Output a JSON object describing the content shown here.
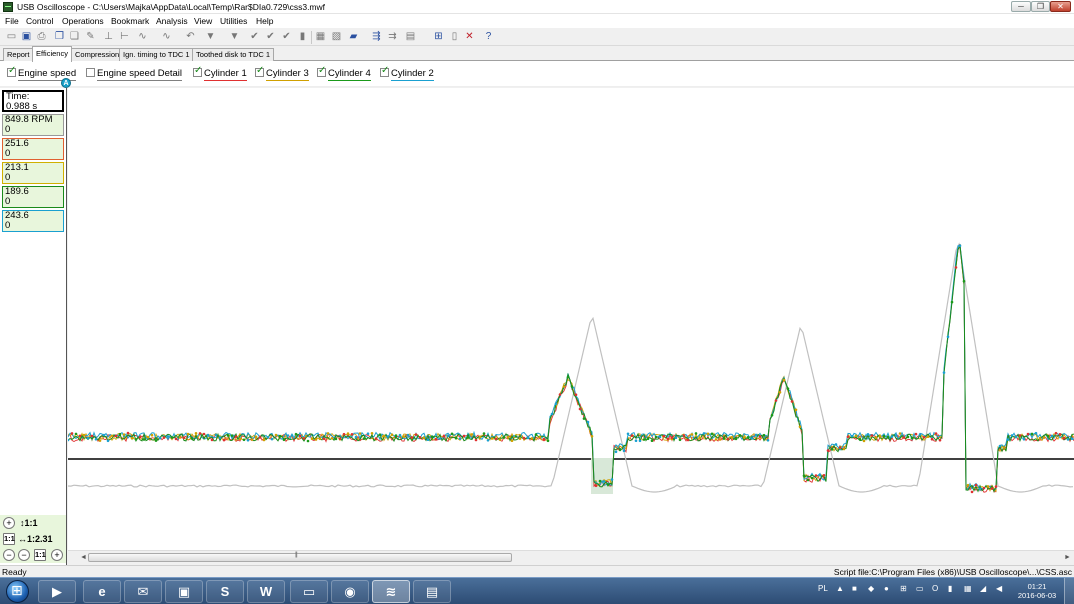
{
  "window": {
    "title": "USB Oscilloscope - C:\\Users\\Majka\\AppData\\Local\\Temp\\Rar$DIa0.729\\css3.mwf",
    "min": "─",
    "max": "❐",
    "close": "✕"
  },
  "menu": [
    "File",
    "Control",
    "Operations",
    "Bookmark",
    "Analysis",
    "View",
    "Utilities",
    "Help"
  ],
  "toolbar_icons": [
    "open-icon",
    "save-icon",
    "print-icon",
    "copy-icon",
    "copy2-icon",
    "edit-icon",
    "cursor-icon",
    "measure-icon",
    "wave-icon",
    "wave2-icon",
    "undo-icon",
    "marker-icon",
    "marker2-icon",
    "check-icon",
    "check2-icon",
    "check3-icon",
    "block-icon",
    "block2-icon",
    "block3-icon",
    "folder-icon",
    "trigger-icon",
    "trigger2-icon",
    "trigger3-icon",
    "display-icon",
    "zoom-icon",
    "view-icon",
    "close-icon",
    "help-icon"
  ],
  "tabs": [
    {
      "label": "Report"
    },
    {
      "label": "Efficiency",
      "active": true
    },
    {
      "label": "Compression"
    },
    {
      "label": "Ign. timing to TDC 1"
    },
    {
      "label": "Toothed disk to TDC 1"
    }
  ],
  "channels": [
    {
      "label": "Engine speed",
      "checked": true,
      "color": "#808080"
    },
    {
      "label": "Engine speed Detail",
      "checked": false,
      "color": "#808080"
    },
    {
      "label": "Cylinder 1",
      "checked": true,
      "color": "#e03030"
    },
    {
      "label": "Cylinder 3",
      "checked": true,
      "color": "#d0a000"
    },
    {
      "label": "Cylinder 4",
      "checked": true,
      "color": "#1a9a1a"
    },
    {
      "label": "Cylinder 2",
      "checked": true,
      "color": "#1aa0d0"
    }
  ],
  "cursor_marker": "A",
  "readouts": [
    {
      "line1": "Time:",
      "line2": "0.988 s",
      "border": "#000000",
      "bg": "#ffffff"
    },
    {
      "line1": "849.8 RPM",
      "line2": "0",
      "border": "#999999",
      "bg": "#e8f6dc"
    },
    {
      "line1": "251.6",
      "line2": "0",
      "border": "#e06030",
      "bg": "#e8f6dc"
    },
    {
      "line1": "213.1",
      "line2": "0",
      "border": "#d0b000",
      "bg": "#e8f6dc"
    },
    {
      "line1": "189.6",
      "line2": "0",
      "border": "#1a8a1a",
      "bg": "#e8f6dc"
    },
    {
      "line1": "243.6",
      "line2": "0",
      "border": "#1aa0d0",
      "bg": "#e8f6dc"
    }
  ],
  "zoom": {
    "y_ratio": "↕1:1",
    "x_ratio": "↔1:2.31",
    "fit_label": "1:1",
    "plus": "+",
    "minus": "−"
  },
  "status": {
    "left": "Ready",
    "right": "Script file:C:\\Program Files (x86)\\USB Oscilloscope\\...\\CSS.asc"
  },
  "taskbar": {
    "apps": [
      {
        "name": "media-player-icon",
        "glyph": "▶"
      },
      {
        "name": "internet-explorer-icon",
        "glyph": "e"
      },
      {
        "name": "thunderbird-icon",
        "glyph": "✉"
      },
      {
        "name": "pictures-icon",
        "glyph": "▣"
      },
      {
        "name": "skype-icon",
        "glyph": "S"
      },
      {
        "name": "word-icon",
        "glyph": "W"
      },
      {
        "name": "explorer-icon",
        "glyph": "▭"
      },
      {
        "name": "chrome-icon",
        "glyph": "◉"
      },
      {
        "name": "oscilloscope-icon",
        "glyph": "≋"
      },
      {
        "name": "winrar-icon",
        "glyph": "▤"
      }
    ],
    "lang": "PL",
    "time": "01:21",
    "date": "2016-06-03"
  }
}
